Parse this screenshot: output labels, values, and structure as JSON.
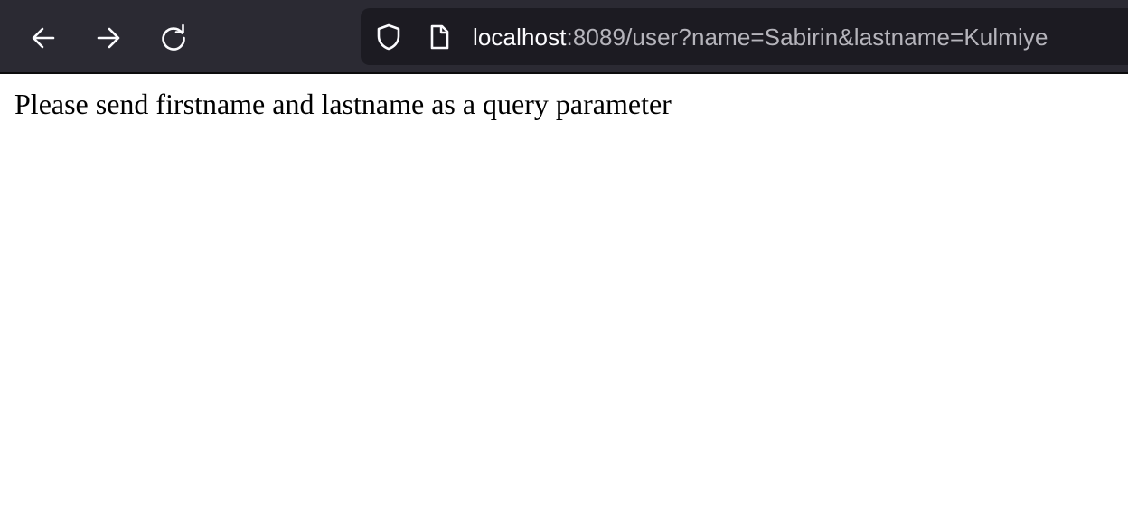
{
  "browser": {
    "url_host": "localhost",
    "url_rest": ":8089/user?name=Sabirin&lastname=Kulmiye",
    "icons": {
      "back": "arrow-left-icon",
      "forward": "arrow-right-icon",
      "reload": "reload-icon",
      "security": "shield-icon",
      "page": "page-icon"
    }
  },
  "page": {
    "message": "Please send firstname and lastname as a query parameter"
  }
}
